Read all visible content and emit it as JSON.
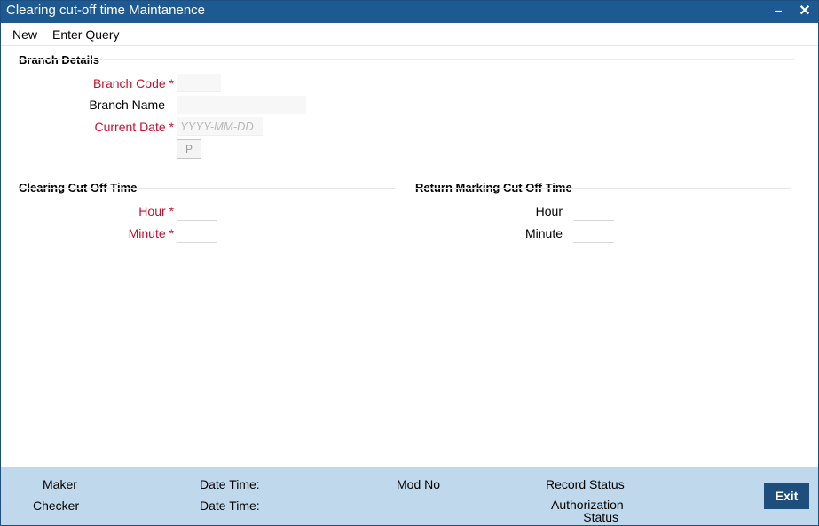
{
  "window": {
    "title": "Clearing cut-off time Maintanence",
    "minimize_icon": "minimize-icon",
    "close_icon": "close-icon"
  },
  "menu": {
    "new_label": "New",
    "enter_query_label": "Enter Query"
  },
  "branch_details": {
    "title": "Branch Details",
    "branch_code_label": "Branch Code",
    "branch_name_label": "Branch Name",
    "current_date_label": "Current Date",
    "current_date_placeholder": "YYYY-MM-DD",
    "p_button_label": "P",
    "required_mark": "*"
  },
  "clearing_cut_off": {
    "title": "Clearing Cut Off Time",
    "hour_label": "Hour",
    "minute_label": "Minute"
  },
  "return_marking": {
    "title": "Return Marking Cut Off Time",
    "hour_label": "Hour",
    "minute_label": "Minute"
  },
  "footer": {
    "maker": "Maker",
    "checker": "Checker",
    "date_time_1": "Date Time:",
    "date_time_2": "Date Time:",
    "mod_no": "Mod No",
    "record_status": "Record Status",
    "authorization_status_line1": "Authorization",
    "authorization_status_line2": "Status",
    "exit_label": "Exit"
  },
  "colors": {
    "titlebar": "#1e5a92",
    "required": "#c8102e",
    "footer": "#c0d8eb",
    "exit_button": "#1e4f7c"
  }
}
